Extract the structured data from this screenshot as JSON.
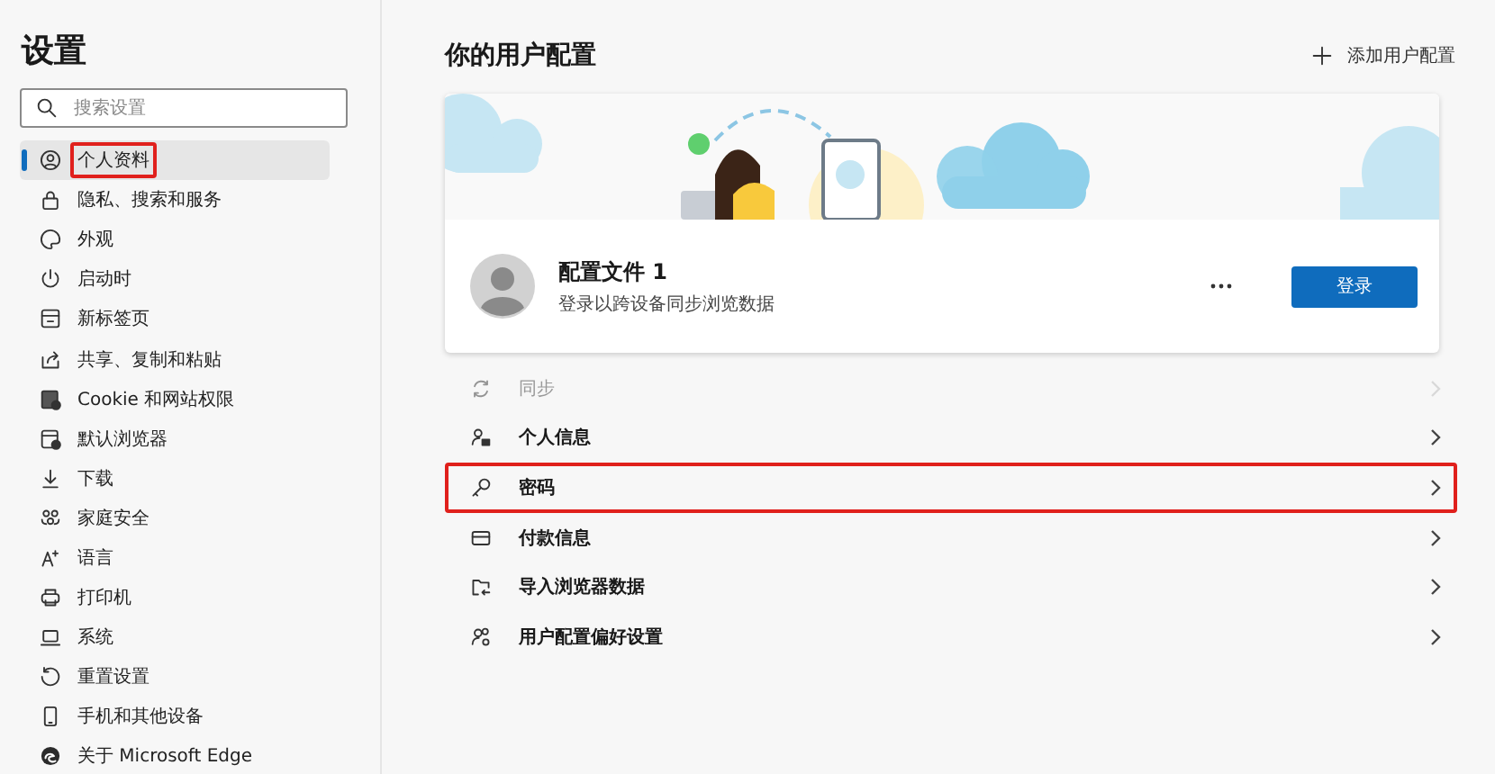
{
  "sidebar": {
    "title": "设置",
    "search": {
      "placeholder": "搜索设置"
    },
    "items": [
      {
        "label": "个人资料",
        "selected": true,
        "highlighted": true
      },
      {
        "label": "隐私、搜索和服务",
        "selected": false,
        "highlighted": false
      },
      {
        "label": "外观",
        "selected": false,
        "highlighted": false
      },
      {
        "label": "启动时",
        "selected": false,
        "highlighted": false
      },
      {
        "label": "新标签页",
        "selected": false,
        "highlighted": false
      },
      {
        "label": "共享、复制和粘贴",
        "selected": false,
        "highlighted": false
      },
      {
        "label": "Cookie 和网站权限",
        "selected": false,
        "highlighted": false
      },
      {
        "label": "默认浏览器",
        "selected": false,
        "highlighted": false
      },
      {
        "label": "下载",
        "selected": false,
        "highlighted": false
      },
      {
        "label": "家庭安全",
        "selected": false,
        "highlighted": false
      },
      {
        "label": "语言",
        "selected": false,
        "highlighted": false
      },
      {
        "label": "打印机",
        "selected": false,
        "highlighted": false
      },
      {
        "label": "系统",
        "selected": false,
        "highlighted": false
      },
      {
        "label": "重置设置",
        "selected": false,
        "highlighted": false
      },
      {
        "label": "手机和其他设备",
        "selected": false,
        "highlighted": false
      },
      {
        "label": "关于 Microsoft Edge",
        "selected": false,
        "highlighted": false
      }
    ]
  },
  "main": {
    "title": "你的用户配置",
    "add_profile": "添加用户配置",
    "profile": {
      "name": "配置文件 1",
      "subtitle": "登录以跨设备同步浏览数据",
      "sign_in": "登录"
    },
    "rows": [
      {
        "label": "同步",
        "disabled": true,
        "highlighted": false
      },
      {
        "label": "个人信息",
        "disabled": false,
        "highlighted": false
      },
      {
        "label": "密码",
        "disabled": false,
        "highlighted": true
      },
      {
        "label": "付款信息",
        "disabled": false,
        "highlighted": false
      },
      {
        "label": "导入浏览器数据",
        "disabled": false,
        "highlighted": false
      },
      {
        "label": "用户配置偏好设置",
        "disabled": false,
        "highlighted": false
      }
    ]
  }
}
